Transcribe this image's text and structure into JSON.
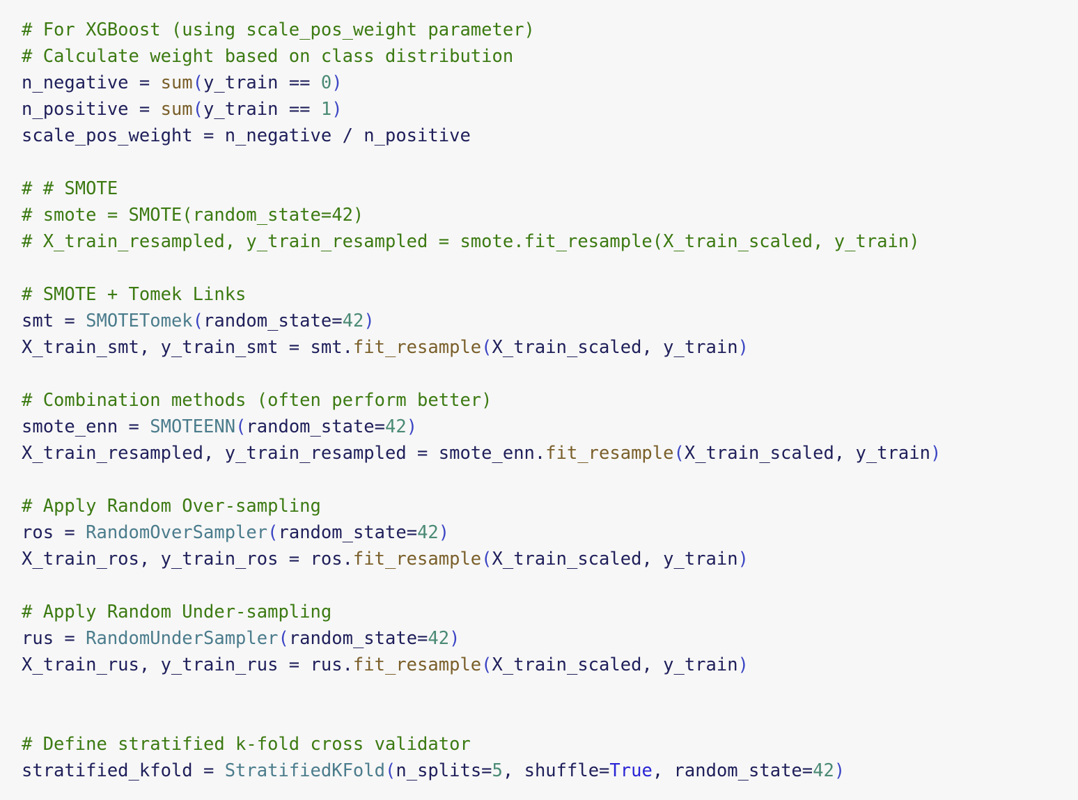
{
  "colors": {
    "background": "#f7f7f7",
    "comment": "#3c7a12",
    "default": "#1f1f5b",
    "builtin": "#7a5f2a",
    "class": "#4b7c8c",
    "number": "#4a8a74",
    "paren": "#3b45c4",
    "keyword": "#2a25d6"
  },
  "code": {
    "language": "python",
    "lines": [
      [
        {
          "t": "comment",
          "v": "# For XGBoost (using scale_pos_weight parameter)"
        }
      ],
      [
        {
          "t": "comment",
          "v": "# Calculate weight based on class distribution"
        }
      ],
      [
        {
          "t": "default",
          "v": "n_negative = "
        },
        {
          "t": "builtin",
          "v": "sum"
        },
        {
          "t": "paren",
          "v": "("
        },
        {
          "t": "default",
          "v": "y_train == "
        },
        {
          "t": "number",
          "v": "0"
        },
        {
          "t": "paren",
          "v": ")"
        }
      ],
      [
        {
          "t": "default",
          "v": "n_positive = "
        },
        {
          "t": "builtin",
          "v": "sum"
        },
        {
          "t": "paren",
          "v": "("
        },
        {
          "t": "default",
          "v": "y_train == "
        },
        {
          "t": "number",
          "v": "1"
        },
        {
          "t": "paren",
          "v": ")"
        }
      ],
      [
        {
          "t": "default",
          "v": "scale_pos_weight = n_negative / n_positive"
        }
      ],
      [],
      [
        {
          "t": "comment",
          "v": "# # SMOTE"
        }
      ],
      [
        {
          "t": "comment",
          "v": "# smote = SMOTE(random_state=42)"
        }
      ],
      [
        {
          "t": "comment",
          "v": "# X_train_resampled, y_train_resampled = smote.fit_resample(X_train_scaled, y_train)"
        }
      ],
      [],
      [
        {
          "t": "comment",
          "v": "# SMOTE + Tomek Links"
        }
      ],
      [
        {
          "t": "default",
          "v": "smt = "
        },
        {
          "t": "class",
          "v": "SMOTETomek"
        },
        {
          "t": "paren",
          "v": "("
        },
        {
          "t": "default",
          "v": "random_state="
        },
        {
          "t": "number",
          "v": "42"
        },
        {
          "t": "paren",
          "v": ")"
        }
      ],
      [
        {
          "t": "default",
          "v": "X_train_smt, y_train_smt = smt."
        },
        {
          "t": "builtin",
          "v": "fit_resample"
        },
        {
          "t": "paren",
          "v": "("
        },
        {
          "t": "default",
          "v": "X_train_scaled, y_train"
        },
        {
          "t": "paren",
          "v": ")"
        }
      ],
      [],
      [
        {
          "t": "comment",
          "v": "# Combination methods (often perform better)"
        }
      ],
      [
        {
          "t": "default",
          "v": "smote_enn = "
        },
        {
          "t": "class",
          "v": "SMOTEENN"
        },
        {
          "t": "paren",
          "v": "("
        },
        {
          "t": "default",
          "v": "random_state="
        },
        {
          "t": "number",
          "v": "42"
        },
        {
          "t": "paren",
          "v": ")"
        }
      ],
      [
        {
          "t": "default",
          "v": "X_train_resampled, y_train_resampled = smote_enn."
        },
        {
          "t": "builtin",
          "v": "fit_resample"
        },
        {
          "t": "paren",
          "v": "("
        },
        {
          "t": "default",
          "v": "X_train_scaled, y_train"
        },
        {
          "t": "paren",
          "v": ")"
        }
      ],
      [],
      [
        {
          "t": "comment",
          "v": "# Apply Random Over-sampling"
        }
      ],
      [
        {
          "t": "default",
          "v": "ros = "
        },
        {
          "t": "class",
          "v": "RandomOverSampler"
        },
        {
          "t": "paren",
          "v": "("
        },
        {
          "t": "default",
          "v": "random_state="
        },
        {
          "t": "number",
          "v": "42"
        },
        {
          "t": "paren",
          "v": ")"
        }
      ],
      [
        {
          "t": "default",
          "v": "X_train_ros, y_train_ros = ros."
        },
        {
          "t": "builtin",
          "v": "fit_resample"
        },
        {
          "t": "paren",
          "v": "("
        },
        {
          "t": "default",
          "v": "X_train_scaled, y_train"
        },
        {
          "t": "paren",
          "v": ")"
        }
      ],
      [],
      [
        {
          "t": "comment",
          "v": "# Apply Random Under-sampling"
        }
      ],
      [
        {
          "t": "default",
          "v": "rus = "
        },
        {
          "t": "class",
          "v": "RandomUnderSampler"
        },
        {
          "t": "paren",
          "v": "("
        },
        {
          "t": "default",
          "v": "random_state="
        },
        {
          "t": "number",
          "v": "42"
        },
        {
          "t": "paren",
          "v": ")"
        }
      ],
      [
        {
          "t": "default",
          "v": "X_train_rus, y_train_rus = rus."
        },
        {
          "t": "builtin",
          "v": "fit_resample"
        },
        {
          "t": "paren",
          "v": "("
        },
        {
          "t": "default",
          "v": "X_train_scaled, y_train"
        },
        {
          "t": "paren",
          "v": ")"
        }
      ],
      [],
      [],
      [
        {
          "t": "comment",
          "v": "# Define stratified k-fold cross validator"
        }
      ],
      [
        {
          "t": "default",
          "v": "stratified_kfold = "
        },
        {
          "t": "class",
          "v": "StratifiedKFold"
        },
        {
          "t": "paren",
          "v": "("
        },
        {
          "t": "default",
          "v": "n_splits="
        },
        {
          "t": "number",
          "v": "5"
        },
        {
          "t": "default",
          "v": ", shuffle="
        },
        {
          "t": "keyword",
          "v": "True"
        },
        {
          "t": "default",
          "v": ", random_state="
        },
        {
          "t": "number",
          "v": "42"
        },
        {
          "t": "paren",
          "v": ")"
        }
      ]
    ]
  }
}
